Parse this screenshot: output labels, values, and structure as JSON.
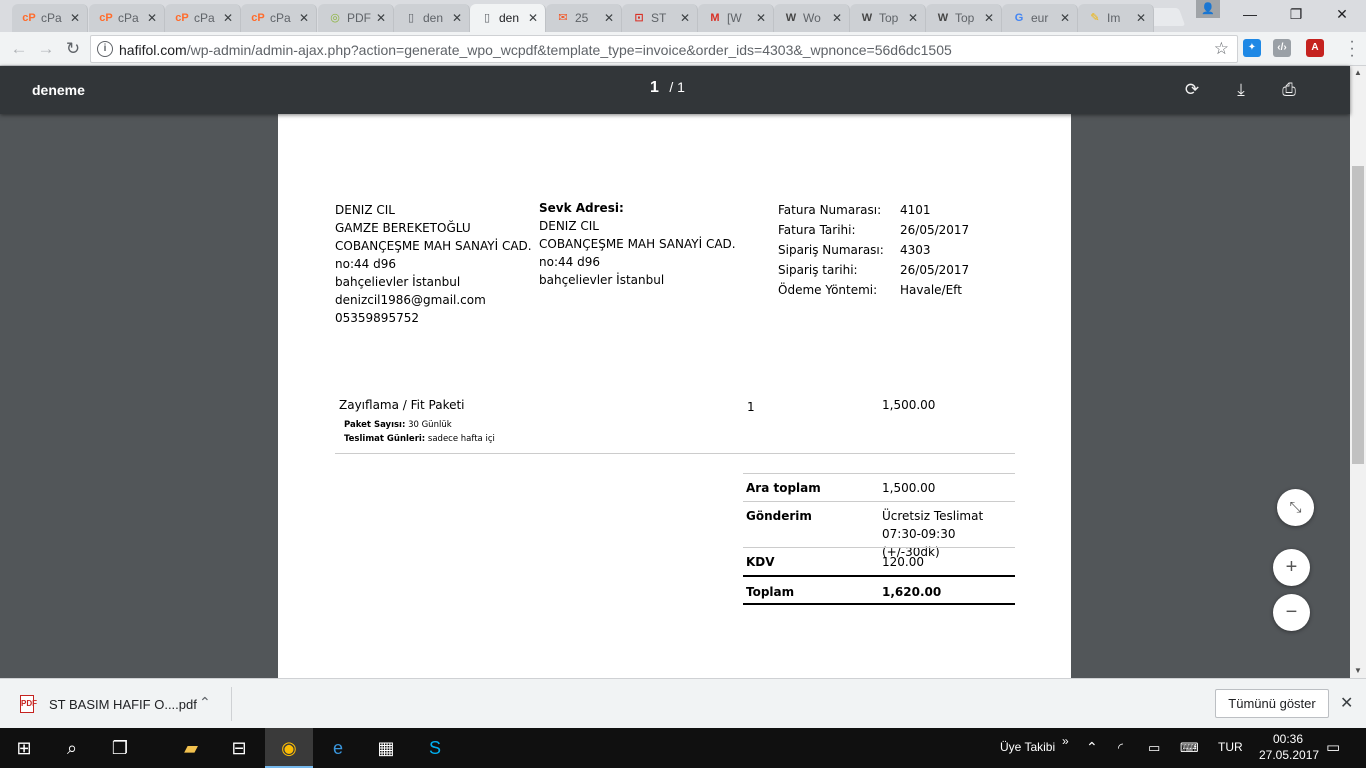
{
  "browser": {
    "tabs": [
      {
        "icon": "cP",
        "icon_color": "#ff6c2c",
        "title": "cPa"
      },
      {
        "icon": "cP",
        "icon_color": "#ff6c2c",
        "title": "cPa"
      },
      {
        "icon": "cP",
        "icon_color": "#ff6c2c",
        "title": "cPa"
      },
      {
        "icon": "cP",
        "icon_color": "#ff6c2c",
        "title": "cPa"
      },
      {
        "icon": "◎",
        "icon_color": "#8bb43a",
        "title": "PDF"
      },
      {
        "icon": "▯",
        "icon_color": "#5f6368",
        "title": "den"
      },
      {
        "icon": "▯",
        "icon_color": "#5f6368",
        "title": "den"
      },
      {
        "icon": "✉",
        "icon_color": "#f4511e",
        "title": "25"
      },
      {
        "icon": "⊡",
        "icon_color": "#d93025",
        "title": "ST"
      },
      {
        "icon": "M",
        "icon_color": "#d93025",
        "title": "[W"
      },
      {
        "icon": "W",
        "icon_color": "#464646",
        "title": "Wo"
      },
      {
        "icon": "W",
        "icon_color": "#464646",
        "title": "Top"
      },
      {
        "icon": "W",
        "icon_color": "#464646",
        "title": "Top"
      },
      {
        "icon": "G",
        "icon_color": "#4285f4",
        "title": "eur"
      },
      {
        "icon": "✎",
        "icon_color": "#f2b400",
        "title": "Im"
      }
    ],
    "tab_close": "✕",
    "address": {
      "host": "hafifol.com",
      "path": "/wp-admin/admin-ajax.php?action=generate_wpo_wcpdf&template_type=invoice&order_ids=4303&_wpnonce=56d6dc1505"
    },
    "icons": {
      "back": "←",
      "forward": "→",
      "reload": "↻",
      "star": "☆",
      "info": "i",
      "minimize": "—",
      "restore": "❐",
      "close": "✕"
    }
  },
  "pdf_viewer": {
    "title": "deneme",
    "page_current": "1",
    "page_total": "/ 1",
    "icons": {
      "rotate": "⟳",
      "download": "⤓",
      "print": "⎙",
      "fit": "⤡",
      "zoom_in": "+",
      "zoom_out": "−"
    }
  },
  "invoice": {
    "billing_address": [
      "DENIZ CIL",
      "GAMZE BEREKETOĞLU",
      "COBANÇEŞME MAH SANAYİ CAD.",
      "no:44 d96",
      "bahçelievler İstanbul",
      "denizcil1986@gmail.com",
      "05359895752"
    ],
    "shipping": {
      "heading": "Sevk Adresi:",
      "lines": [
        "DENIZ CIL",
        "COBANÇEŞME MAH SANAYİ CAD.",
        "no:44 d96",
        "bahçelievler İstanbul"
      ]
    },
    "meta": [
      {
        "label": "Fatura Numarası:",
        "value": "4101"
      },
      {
        "label": "Fatura Tarihi:",
        "value": "26/05/2017"
      },
      {
        "label": "Sipariş Numarası:",
        "value": "4303"
      },
      {
        "label": "Sipariş tarihi:",
        "value": "26/05/2017"
      },
      {
        "label": "Ödeme Yöntemi:",
        "value": "Havale/Eft"
      }
    ],
    "item": {
      "name": "Zayıflama / Fit Paketi",
      "meta": [
        {
          "label": "Paket Sayısı:",
          "value": "30 Günlük"
        },
        {
          "label": "Teslimat Günleri:",
          "value": "sadece hafta içi"
        }
      ],
      "quantity": "1",
      "price": "1,500.00"
    },
    "totals": [
      {
        "label": "Ara toplam",
        "value": [
          "1,500.00"
        ]
      },
      {
        "label": "Gönderim",
        "value": [
          "Ücretsiz Teslimat",
          "07:30-09:30 (+/-30dk)"
        ]
      },
      {
        "label": "KDV",
        "value": [
          "120.00"
        ]
      },
      {
        "label": "Toplam",
        "value": [
          "1,620.00"
        ]
      }
    ]
  },
  "download_shelf": {
    "file_name": "ST BASIM HAFIF O....pdf",
    "show_all": "Tümünü göster",
    "caret": "⌃",
    "close": "✕"
  },
  "taskbar": {
    "tray_label": "Üye Takibi",
    "tray_more": "»",
    "tray_up": "⌃",
    "language": "TUR",
    "time": "00:36",
    "date": "27.05.2017"
  }
}
